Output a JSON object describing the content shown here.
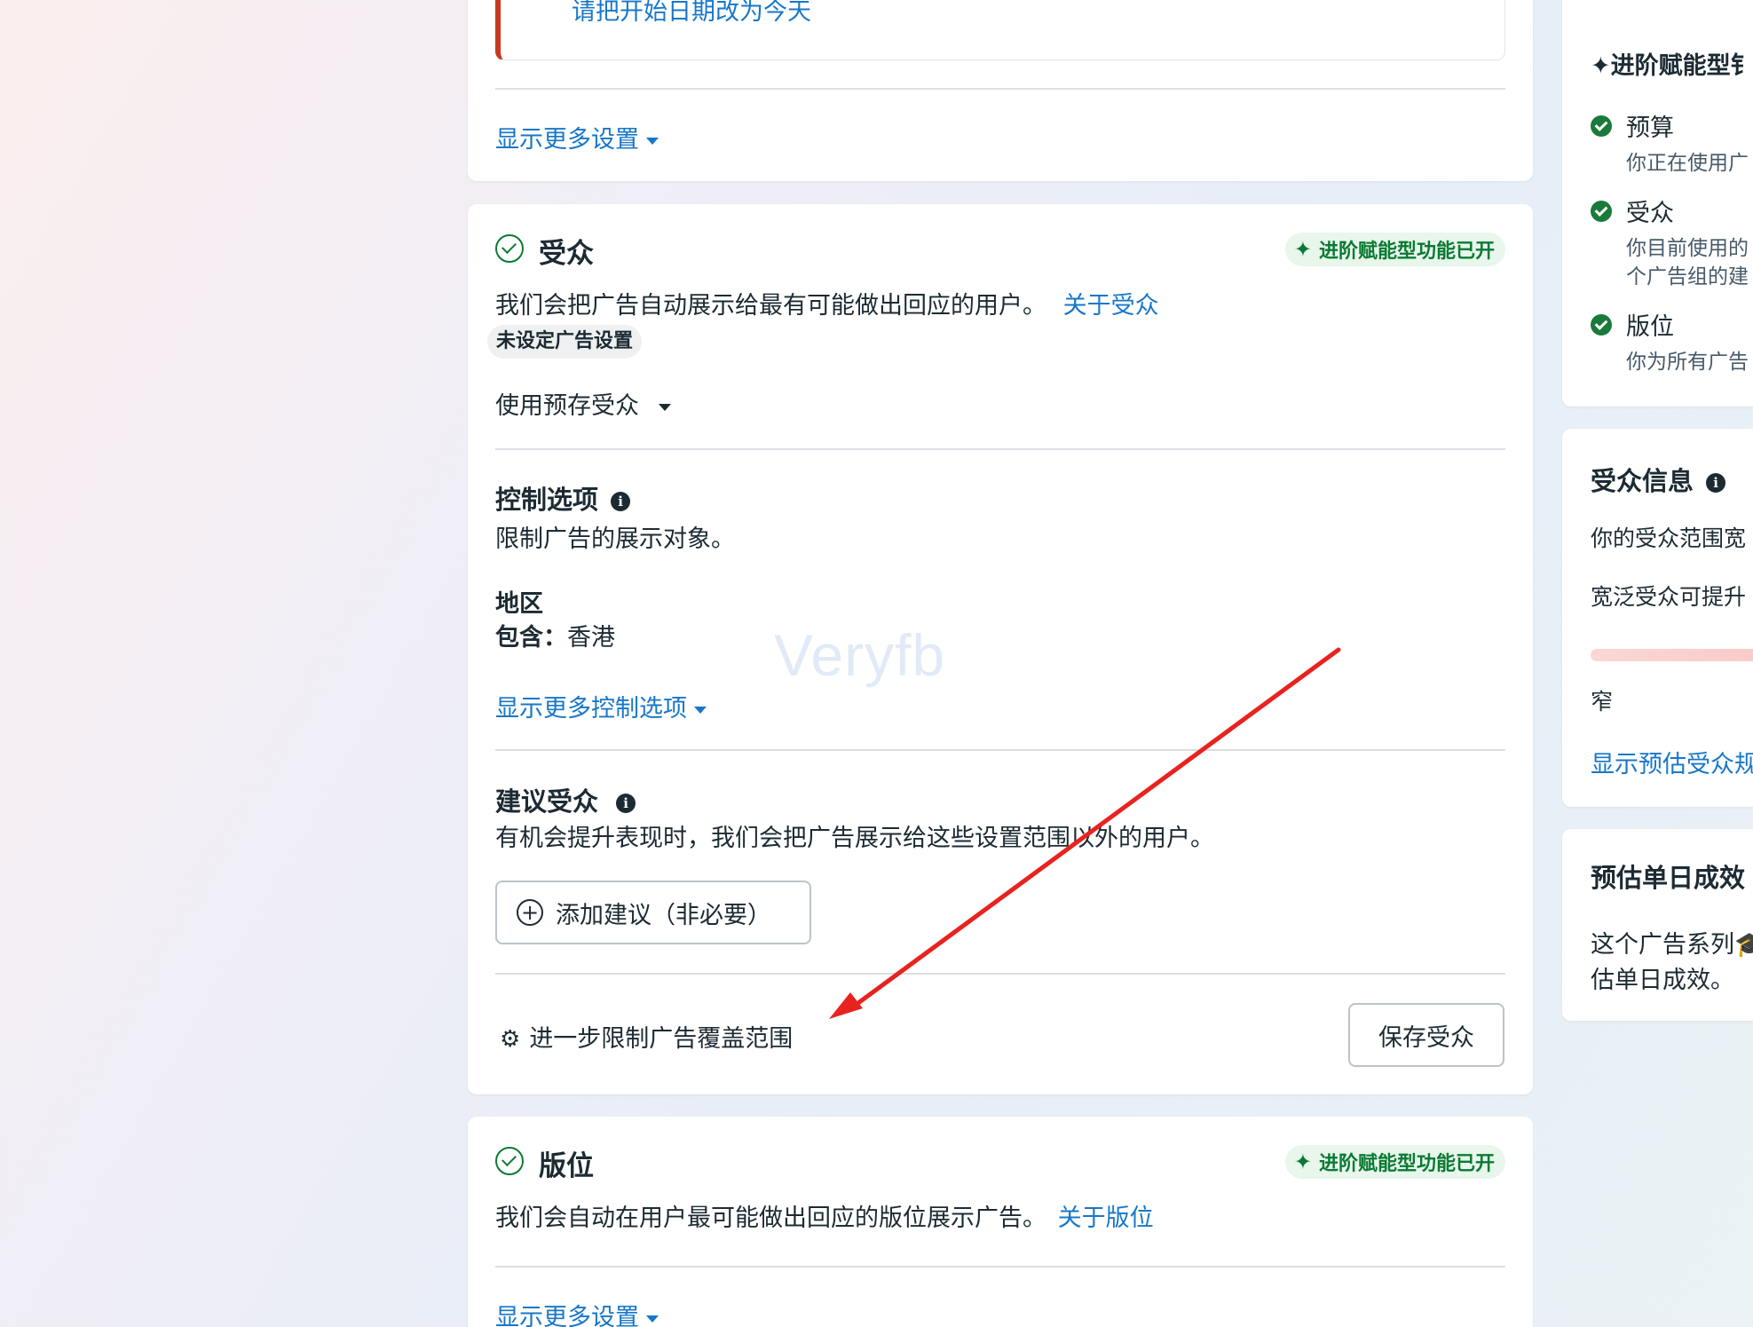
{
  "prev_section": {
    "alert_link": "请把开始日期改为今天",
    "show_more_settings": "显示更多设置"
  },
  "audience": {
    "title": "受众",
    "badge": "进阶赋能型功能已开",
    "description": "我们会把广告自动展示给最有可能做出回应的用户。",
    "about_link": "关于受众",
    "unset_tag": "未设定广告设置",
    "saved_audience_dropdown": "使用预存受众",
    "controls": {
      "title": "控制选项",
      "description": "限制广告的展示对象。",
      "region_label": "地区",
      "include_label": "包含：",
      "include_value": "香港",
      "show_more": "显示更多控制选项"
    },
    "suggestions": {
      "title": "建议受众",
      "description": "有机会提升表现时，我们会把广告展示给这些设置范围以外的用户。",
      "add_button": "添加建议（非必要）"
    },
    "further_limit": "进一步限制广告覆盖范围",
    "save_button": "保存受众"
  },
  "placements": {
    "title": "版位",
    "badge": "进阶赋能型功能已开",
    "description": "我们会自动在用户最可能做出回应的版位展示广告。",
    "about_link": "关于版位",
    "show_more_settings": "显示更多设置"
  },
  "watermark": "Veryfb",
  "sidebar": {
    "advantage_title": "进阶赋能型钅",
    "items": [
      {
        "title": "预算",
        "line1": "你正在使用广"
      },
      {
        "title": "受众",
        "line1": "你目前使用的",
        "line2": "个广告组的建"
      },
      {
        "title": "版位",
        "line1": "你为所有广告"
      }
    ],
    "audience_info": {
      "title": "受众信息",
      "line1": "你的受众范围宽",
      "line2": "宽泛受众可提升",
      "narrow_label": "窄",
      "show_estimate": "显示预估受众规"
    },
    "daily_results": {
      "title": "预估单日成效",
      "line1": "这个广告系列🎓",
      "line2": "估单日成效。"
    }
  },
  "colors": {
    "link": "#1877c9",
    "green": "#0a7a32",
    "alert_red": "#c8381f",
    "arrow_red": "#e8231f"
  }
}
